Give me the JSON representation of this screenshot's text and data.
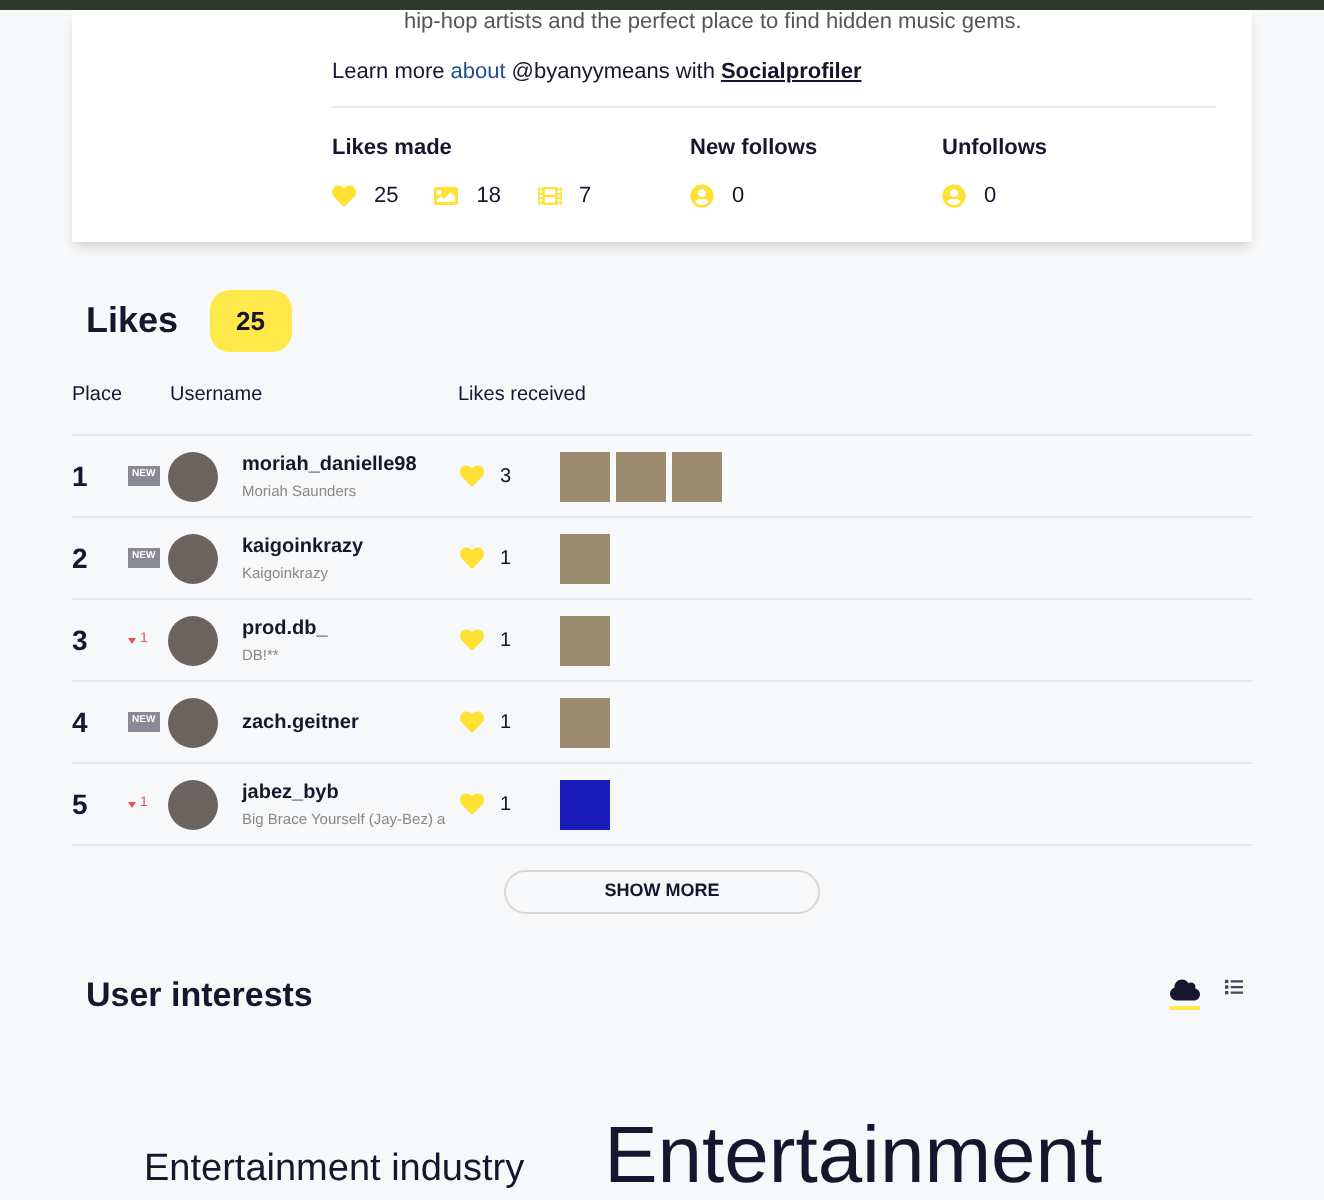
{
  "profile_card": {
    "bio_tail": "hip-hop artists and the perfect place to find hidden music gems.",
    "learn_more": {
      "prefix": "Learn more",
      "link": "about",
      "middle": "@byanyymeans with",
      "brand": "Socialprofiler"
    },
    "stats": [
      {
        "label": "Likes made",
        "items": [
          {
            "kind": "heart",
            "value": "25"
          },
          {
            "kind": "image",
            "value": "18"
          },
          {
            "kind": "film",
            "value": "7"
          }
        ]
      },
      {
        "label": "New follows",
        "items": [
          {
            "kind": "user",
            "value": "0"
          }
        ]
      },
      {
        "label": "Unfollows",
        "items": [
          {
            "kind": "user",
            "value": "0"
          }
        ]
      }
    ]
  },
  "likes": {
    "title": "Likes",
    "count": "25",
    "columns": [
      "Place",
      "Username",
      "Likes received"
    ],
    "rows": [
      {
        "place": "1",
        "change": {
          "kind": "new",
          "text": "NEW"
        },
        "username": "moriah_danielle98",
        "name": "Moriah Saunders",
        "likes": "3",
        "thumbnails": [
          {
            "kind": "photo"
          },
          {
            "kind": "photo"
          },
          {
            "kind": "photo"
          }
        ]
      },
      {
        "place": "2",
        "change": {
          "kind": "new",
          "text": "NEW"
        },
        "username": "kaigoinkrazy",
        "name": "Kaigoinkrazy",
        "likes": "1",
        "thumbnails": [
          {
            "kind": "photo"
          }
        ]
      },
      {
        "place": "3",
        "change": {
          "kind": "down",
          "text": "1"
        },
        "username": "prod.db_",
        "name": "DB!**",
        "likes": "1",
        "thumbnails": [
          {
            "kind": "photo"
          }
        ]
      },
      {
        "place": "4",
        "change": {
          "kind": "new",
          "text": "NEW"
        },
        "username": "zach.geitner",
        "likes": "1",
        "thumbnails": [
          {
            "kind": "photo"
          }
        ]
      },
      {
        "place": "5",
        "change": {
          "kind": "down",
          "text": "1"
        },
        "username": "jabez_byb",
        "name": "Big Brace Yourself (Jay-Bez) a",
        "likes": "1",
        "thumbnails": [
          {
            "kind": "dark-photo"
          }
        ]
      }
    ],
    "show_more": "SHOW MORE"
  },
  "interests": {
    "title": "User interests",
    "views": [
      {
        "kind": "cloud",
        "selected": true
      },
      {
        "kind": "list",
        "selected": false
      }
    ],
    "words": [
      {
        "text": "Entertainment industry",
        "kind": "small"
      },
      {
        "text": "Entertainment",
        "kind": "large"
      }
    ]
  }
}
